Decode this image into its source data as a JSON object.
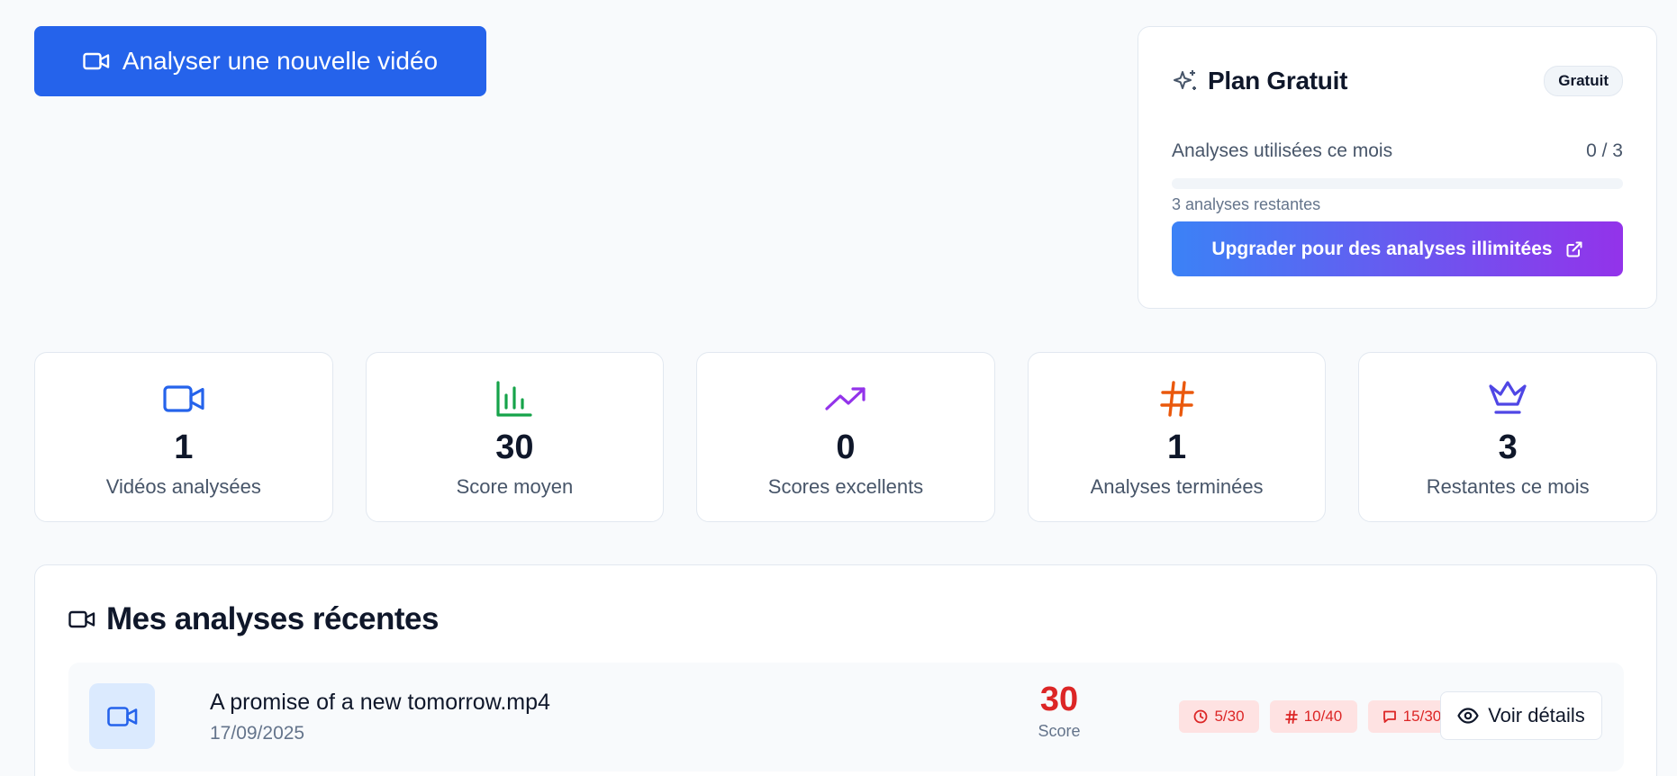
{
  "actions": {
    "analyse_button": "Analyser une nouvelle vidéo"
  },
  "plan": {
    "title": "Plan Gratuit",
    "badge": "Gratuit",
    "usage_label": "Analyses utilisées ce mois",
    "usage_value": "0 / 3",
    "usage_fraction": 0,
    "remaining_text": "3 analyses restantes",
    "upgrade_button": "Upgrader pour des analyses illimitées"
  },
  "stats": [
    {
      "icon": "video-icon",
      "value": "1",
      "label": "Vidéos analysées",
      "color": "#2563eb"
    },
    {
      "icon": "bar-chart-icon",
      "value": "30",
      "label": "Score moyen",
      "color": "#16a34a"
    },
    {
      "icon": "trending-up-icon",
      "value": "0",
      "label": "Scores excellents",
      "color": "#9333ea"
    },
    {
      "icon": "hash-icon",
      "value": "1",
      "label": "Analyses terminées",
      "color": "#ea580c"
    },
    {
      "icon": "crown-icon",
      "value": "3",
      "label": "Restantes ce mois",
      "color": "#4f46e5"
    }
  ],
  "recent": {
    "title": "Mes analyses récentes",
    "items": [
      {
        "file_name": "A promise of a new tomorrow.mp4",
        "date": "17/09/2025",
        "score": "30",
        "score_label": "Score",
        "metrics": [
          {
            "icon": "clock-icon",
            "value": "5/30"
          },
          {
            "icon": "hash-icon",
            "value": "10/40"
          },
          {
            "icon": "message-icon",
            "value": "15/30"
          }
        ],
        "details_button": "Voir détails"
      }
    ]
  },
  "colors": {
    "primary": "#2563eb",
    "score_bad": "#dc2626",
    "score_bad_bg": "#fee2e2",
    "gradient_start": "#3b82f6",
    "gradient_end": "#9333ea"
  }
}
